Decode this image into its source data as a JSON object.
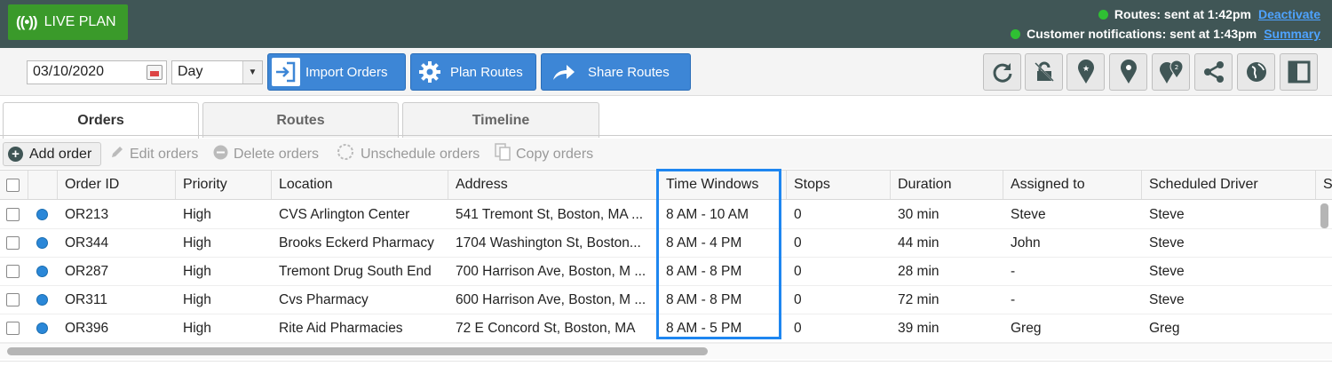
{
  "header": {
    "live_plan_label": "LIVE PLAN",
    "live_icon_glyph": "((•))",
    "routes_status": "Routes: sent at 1:42pm",
    "deactivate_link": "Deactivate",
    "notifications_status": "Customer notifications: sent at 1:43pm",
    "summary_link": "Summary"
  },
  "toolbar": {
    "date_value": "03/10/2020",
    "view_value": "Day",
    "import_label": "Import Orders",
    "plan_label": "Plan Routes",
    "share_label": "Share Routes",
    "icon_buttons": [
      "refresh-icon",
      "unlock-icon",
      "pin-star-icon",
      "pin-icon",
      "multi-pin-icon",
      "share-icon",
      "globe-icon",
      "panel-icon"
    ]
  },
  "tabs": [
    "Orders",
    "Routes",
    "Timeline"
  ],
  "actions": {
    "add": "Add order",
    "edit": "Edit orders",
    "delete": "Delete orders",
    "unschedule": "Unschedule orders",
    "copy": "Copy orders"
  },
  "table": {
    "columns": [
      "Order ID",
      "Priority",
      "Location",
      "Address",
      "Time Windows",
      "Stops",
      "Duration",
      "Assigned to",
      "Scheduled Driver",
      "S"
    ],
    "rows": [
      {
        "id": "OR213",
        "priority": "High",
        "location": "CVS Arlington Center",
        "address": "541 Tremont St, Boston, MA ...",
        "time": "8 AM - 10 AM",
        "stops": "0",
        "duration": "30 min",
        "assigned": "Steve",
        "driver": "Steve"
      },
      {
        "id": "OR344",
        "priority": "High",
        "location": "Brooks Eckerd Pharmacy",
        "address": "1704 Washington St, Boston...",
        "time": "8 AM - 4 PM",
        "stops": "0",
        "duration": "44 min",
        "assigned": "John",
        "driver": "Steve"
      },
      {
        "id": "OR287",
        "priority": "High",
        "location": "Tremont Drug South End",
        "address": "700 Harrison Ave, Boston, M ...",
        "time": "8 AM - 8 PM",
        "stops": "0",
        "duration": "28 min",
        "assigned": "-",
        "driver": "Steve"
      },
      {
        "id": "OR311",
        "priority": "High",
        "location": "Cvs Pharmacy",
        "address": "600 Harrison Ave, Boston, M ...",
        "time": "8 AM - 8 PM",
        "stops": "0",
        "duration": "72 min",
        "assigned": "-",
        "driver": "Steve"
      },
      {
        "id": "OR396",
        "priority": "High",
        "location": "Rite Aid Pharmacies",
        "address": "72 E Concord St, Boston, MA",
        "time": "8 AM - 5 PM",
        "stops": "0",
        "duration": "39 min",
        "assigned": "Greg",
        "driver": "Greg"
      }
    ]
  },
  "colors": {
    "header_bg": "#405656",
    "live_green": "#3a9a2a",
    "primary_blue": "#3d86d6",
    "highlight_blue": "#1e86f0",
    "status_green": "#2fbf33"
  }
}
